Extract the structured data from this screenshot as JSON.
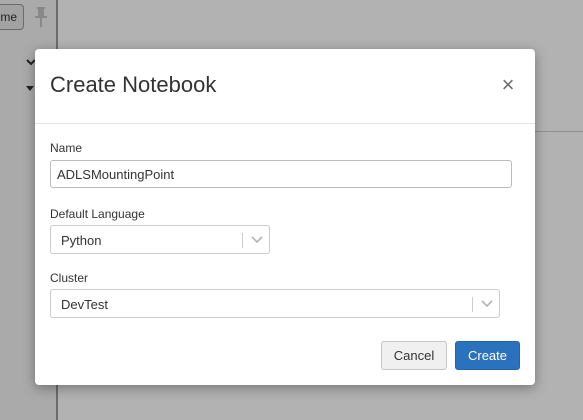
{
  "background": {
    "home_button_label": "me"
  },
  "dialog": {
    "title": "Create Notebook",
    "close_symbol": "×",
    "name_field": {
      "label": "Name",
      "value": "ADLSMountingPoint"
    },
    "language_field": {
      "label": "Default Language",
      "selected": "Python"
    },
    "cluster_field": {
      "label": "Cluster",
      "selected": "DevTest"
    },
    "cancel_label": "Cancel",
    "create_label": "Create"
  },
  "colors": {
    "primary": "#2a72bd",
    "overlay": "rgba(0,0,0,0.3)"
  },
  "icons": [
    "pin-icon",
    "chevron-down-icon",
    "close-icon"
  ]
}
